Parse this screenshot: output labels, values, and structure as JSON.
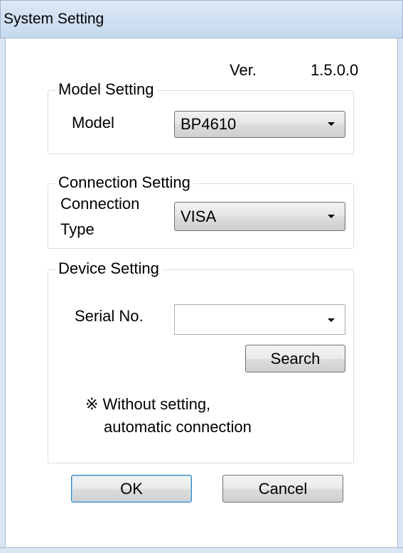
{
  "window": {
    "title": "System Setting"
  },
  "version": {
    "label": "Ver.",
    "value": "1.5.0.0"
  },
  "model_setting": {
    "group_title": "Model Setting",
    "model_label": "Model",
    "model_value": "BP4610"
  },
  "connection_setting": {
    "group_title": "Connection Setting",
    "type_label_line1": "Connection",
    "type_label_line2": "Type",
    "type_value": "VISA"
  },
  "device_setting": {
    "group_title": "Device Setting",
    "serial_label": "Serial No.",
    "serial_value": "",
    "search_button": "Search",
    "note_line1": "※ Without setting,",
    "note_line2": "automatic connection"
  },
  "buttons": {
    "ok": "OK",
    "cancel": "Cancel"
  },
  "icons": {
    "dropdown": "chevron-down-icon"
  },
  "colors": {
    "titlebar": "#c6d9ee",
    "default_button_border": "#3c7fb1",
    "group_border": "#d5dfe5"
  }
}
